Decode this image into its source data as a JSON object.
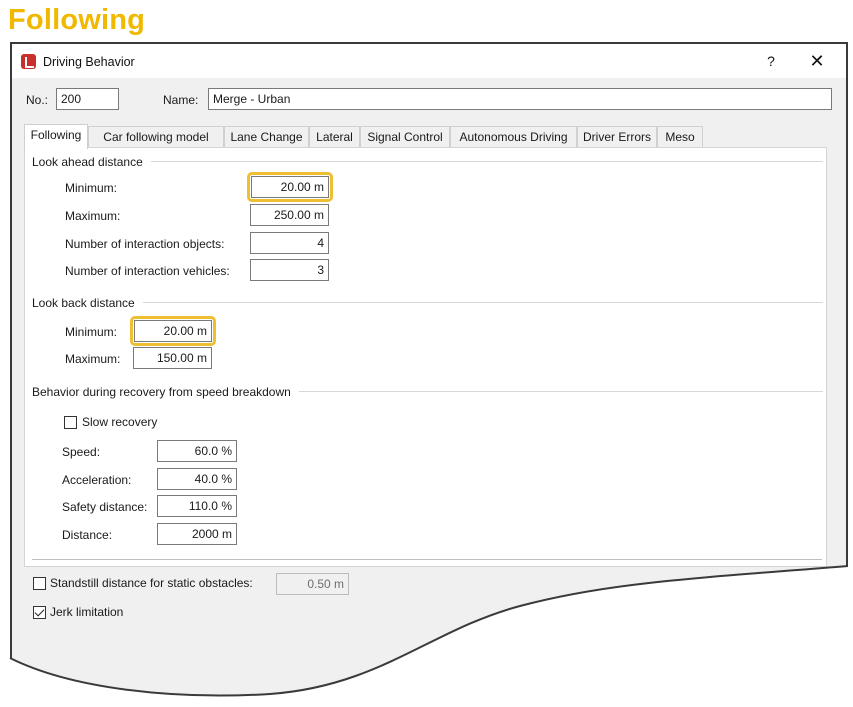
{
  "heading": "Following",
  "window": {
    "title": "Driving Behavior",
    "help_label": "?",
    "close_label": "✕"
  },
  "header": {
    "no_label": "No.:",
    "no_value": "200",
    "name_label": "Name:",
    "name_value": "Merge - Urban"
  },
  "tabs": [
    {
      "label": "Following",
      "active": true
    },
    {
      "label": "Car following model"
    },
    {
      "label": "Lane Change"
    },
    {
      "label": "Lateral"
    },
    {
      "label": "Signal Control"
    },
    {
      "label": "Autonomous Driving"
    },
    {
      "label": "Driver Errors"
    },
    {
      "label": "Meso"
    }
  ],
  "look_ahead": {
    "title": "Look ahead distance",
    "min_label": "Minimum:",
    "min_value": "20.00 m",
    "max_label": "Maximum:",
    "max_value": "250.00 m",
    "objects_label": "Number of interaction objects:",
    "objects_value": "4",
    "vehicles_label": "Number of interaction vehicles:",
    "vehicles_value": "3"
  },
  "look_back": {
    "title": "Look back distance",
    "min_label": "Minimum:",
    "min_value": "20.00 m",
    "max_label": "Maximum:",
    "max_value": "150.00 m"
  },
  "recovery": {
    "title": "Behavior during recovery from speed breakdown",
    "slow_label": "Slow recovery",
    "slow_checked": false,
    "speed_label": "Speed:",
    "speed_value": "60.0 %",
    "accel_label": "Acceleration:",
    "accel_value": "40.0 %",
    "safety_label": "Safety distance:",
    "safety_value": "110.0 %",
    "distance_label": "Distance:",
    "distance_value": "2000 m"
  },
  "standstill": {
    "label": "Standstill distance for static obstacles:",
    "checked": false,
    "value": "0.50 m"
  },
  "jerk": {
    "label": "Jerk limitation",
    "checked": true
  },
  "colors": {
    "heading": "#f1b800",
    "highlight": "#efbf33",
    "app_icon": "#c9302c"
  }
}
